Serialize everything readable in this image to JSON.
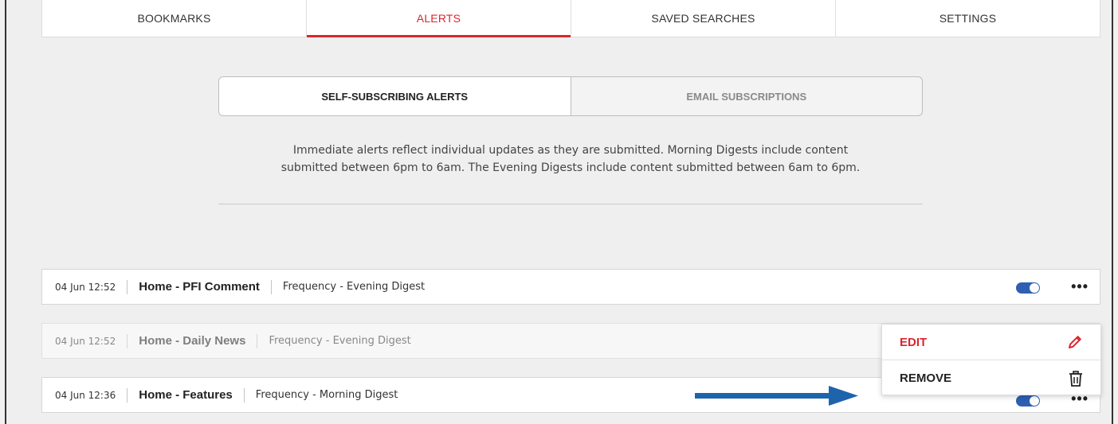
{
  "tabs": [
    {
      "label": "BOOKMARKS",
      "active": false
    },
    {
      "label": "ALERTS",
      "active": true
    },
    {
      "label": "SAVED SEARCHES",
      "active": false
    },
    {
      "label": "SETTINGS",
      "active": false
    }
  ],
  "segmented": {
    "active_label": "SELF-SUBSCRIBING ALERTS",
    "inactive_label": "EMAIL SUBSCRIPTIONS"
  },
  "description": {
    "line1": "Immediate alerts reflect individual updates as they are submitted. Morning Digests include content",
    "line2": "submitted between 6pm to 6am. The Evening Digests include content submitted between 6am to 6pm."
  },
  "alerts": [
    {
      "date": "04 Jun 12:52",
      "name": "Home - PFI Comment",
      "frequency": "Frequency - Evening Digest",
      "enabled": true
    },
    {
      "date": "04 Jun 12:52",
      "name": "Home - Daily News",
      "frequency": "Frequency - Evening Digest",
      "enabled": true
    },
    {
      "date": "04 Jun 12:36",
      "name": "Home - Features",
      "frequency": "Frequency - Morning Digest",
      "enabled": true
    }
  ],
  "menu": {
    "edit_label": "EDIT",
    "remove_label": "REMOVE",
    "edit_icon": "pencil-icon",
    "remove_icon": "trash-icon"
  },
  "more_label": "•••",
  "colors": {
    "accent": "#d8272f",
    "toggle": "#2e5fb3",
    "arrow": "#1e64ad"
  }
}
